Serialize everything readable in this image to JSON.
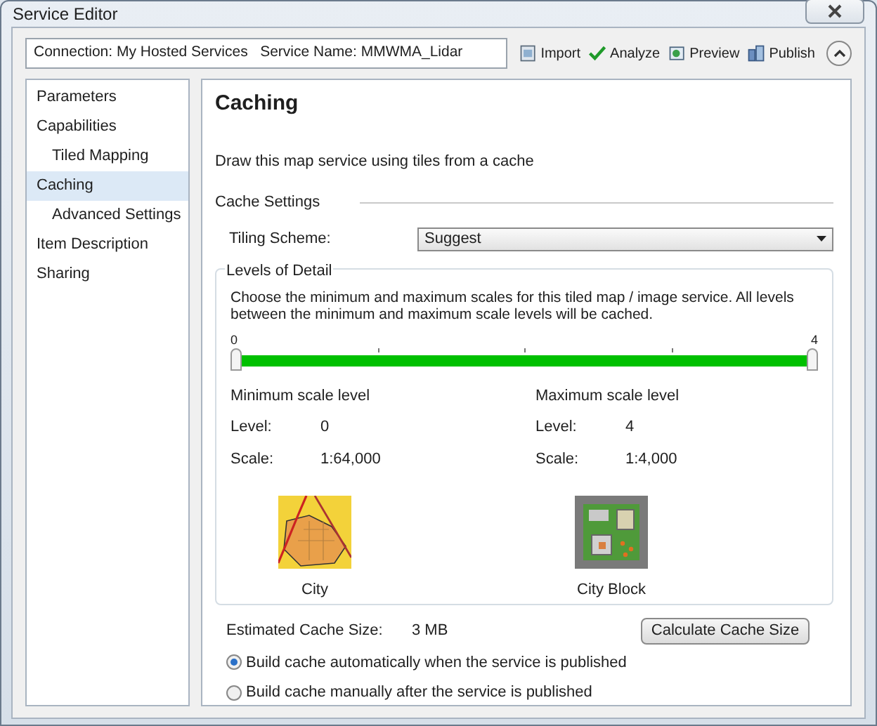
{
  "window": {
    "title": "Service Editor"
  },
  "connection": {
    "text": "Connection: My Hosted Services   Service Name: MMWMA_Lidar"
  },
  "toolbar": [
    {
      "kind": "import",
      "label": "Import"
    },
    {
      "kind": "analyze",
      "label": "Analyze"
    },
    {
      "kind": "preview",
      "label": "Preview"
    },
    {
      "kind": "publish",
      "label": "Publish"
    }
  ],
  "sidebar": {
    "items": [
      {
        "label": "Parameters",
        "selected": false
      },
      {
        "label": "Capabilities",
        "selected": false,
        "children": [
          {
            "label": "Tiled Mapping",
            "selected": false
          }
        ]
      },
      {
        "label": "Caching",
        "selected": true,
        "children": [
          {
            "label": "Advanced Settings",
            "selected": false
          }
        ]
      },
      {
        "label": "Item Description",
        "selected": false
      },
      {
        "label": "Sharing",
        "selected": false
      }
    ]
  },
  "panel": {
    "title": "Caching",
    "description": "Draw this map service using tiles from a cache",
    "section": "Cache Settings",
    "tiling_scheme": {
      "label": "Tiling Scheme:",
      "value": "Suggest"
    },
    "levels": {
      "title": "Levels of Detail",
      "description": "Choose the minimum and maximum scales for this tiled map / image service. All levels between the minimum and maximum scale levels will be cached.",
      "slider": {
        "min_label": "0",
        "max_label": "4",
        "level": 1
      },
      "scales": [
        {
          "heading": "Minimum scale level",
          "level_label": "Level:",
          "level": "0",
          "scale_label": "Scale:",
          "scale": "1:64,000",
          "kind": "city",
          "caption": "City"
        },
        {
          "heading": "Maximum scale level",
          "level_label": "Level:",
          "level": "4",
          "scale_label": "Scale:",
          "scale": "1:4,000",
          "kind": "block",
          "caption": "City Block"
        }
      ]
    },
    "estimate": {
      "label": "Estimated Cache Size:",
      "value": "3 MB",
      "button": "Calculate Cache Size"
    },
    "options": [
      {
        "label": "Build cache automatically when the service is published",
        "selected": true
      },
      {
        "label": "Build cache manually after the service is published",
        "selected": false
      }
    ]
  }
}
